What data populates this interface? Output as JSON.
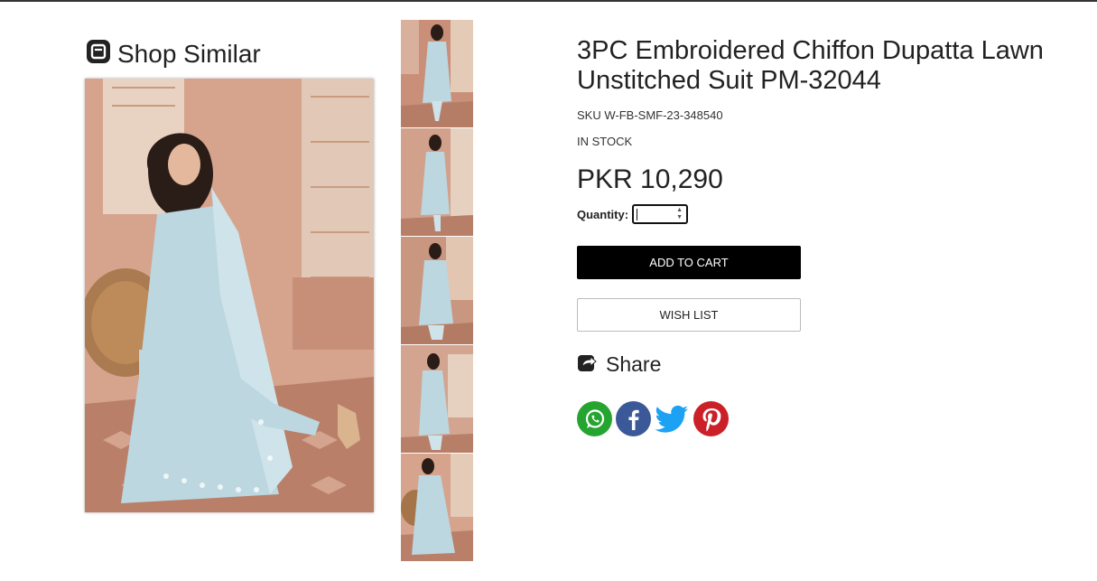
{
  "header": {
    "shop_similar_label": "Shop Similar"
  },
  "product": {
    "title": "3PC Embroidered Chiffon Dupatta Lawn Unstitched Suit PM-32044",
    "sku": "SKU W-FB-SMF-23-348540",
    "stock_status": "IN STOCK",
    "price": "PKR 10,290",
    "quantity_label": "Quantity:",
    "quantity_value": ""
  },
  "actions": {
    "add_to_cart_label": "ADD TO CART",
    "wish_list_label": "WISH LIST",
    "share_label": "Share"
  },
  "social": [
    {
      "name": "whatsapp",
      "color": "#25a530"
    },
    {
      "name": "facebook",
      "color": "#3b5998"
    },
    {
      "name": "twitter",
      "color": "#1da1f2"
    },
    {
      "name": "pinterest",
      "color": "#cb2027"
    }
  ],
  "colors": {
    "outfit": "#bcd7e0",
    "wall": "#d9a48c",
    "floor": "#b9826b"
  }
}
